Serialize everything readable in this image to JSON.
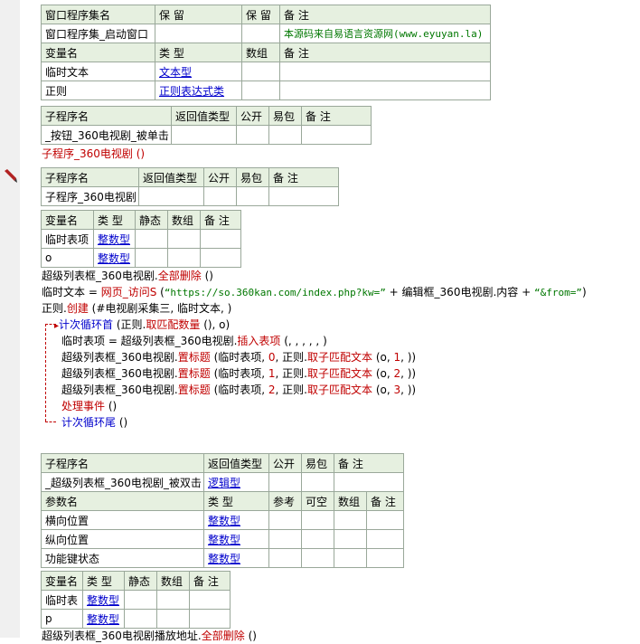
{
  "assembly_table": {
    "headers": [
      "窗口程序集名",
      "保 留",
      "保 留",
      "备 注"
    ],
    "row": {
      "name": "窗口程序集_启动窗口",
      "r1": "",
      "r2": "",
      "note": "本源码来自易语言资源网(www.eyuyan.la)"
    },
    "var_headers": [
      "变量名",
      "类 型",
      "数组",
      "备 注"
    ],
    "vars": [
      {
        "name": "临时文本",
        "type": "文本型",
        "arr": "",
        "note": ""
      },
      {
        "name": "正则",
        "type": "正则表达式类",
        "arr": "",
        "note": ""
      }
    ]
  },
  "sub1": {
    "headers": [
      "子程序名",
      "返回值类型",
      "公开",
      "易包",
      "备 注"
    ],
    "name": "_按钮_360电视剧_被单击",
    "call_line": "子程序_360电视剧 ()"
  },
  "sub2": {
    "headers": [
      "子程序名",
      "返回值类型",
      "公开",
      "易包",
      "备 注"
    ],
    "name": "子程序_360电视剧",
    "var_headers": [
      "变量名",
      "类 型",
      "静态",
      "数组",
      "备 注"
    ],
    "vars": [
      {
        "name": "临时表项",
        "type": "整数型"
      },
      {
        "name": "o",
        "type": "整数型"
      }
    ],
    "code": {
      "l1a": "超级列表框_360电视剧.",
      "l1b": "全部删除",
      "l1c": " ()",
      "l2a": "临时文本 = ",
      "l2b": "网页_访问S",
      "l2c": " (",
      "l2d": "“https://so.360kan.com/index.php?kw=”",
      "l2e": " + 编辑框_360电视剧.内容 + ",
      "l2f": "“&from=”",
      "l2g": ")",
      "l3a": "正则.",
      "l3b": "创建",
      "l3c": " (#电视剧采集三, 临时文本, )",
      "l4a": "计次循环首",
      "l4b": " (正则.",
      "l4c": "取匹配数量",
      "l4d": " (), o)",
      "l5a": "临时表项 = 超级列表框_360电视剧.",
      "l5b": "插入表项",
      "l5c": " (, , , , , )",
      "l6a": "超级列表框_360电视剧.",
      "l6b": "置标题",
      "l6c": " (临时表项, ",
      "l6d": "0",
      "l6e": ", 正则.",
      "l6f": "取子匹配文本",
      "l6g": " (o, ",
      "l6h": "1",
      "l6i": ", ))",
      "l7a": "超级列表框_360电视剧.",
      "l7b": "置标题",
      "l7c": " (临时表项, ",
      "l7d": "1",
      "l7e": ", 正则.",
      "l7f": "取子匹配文本",
      "l7g": " (o, ",
      "l7h": "2",
      "l7i": ", ))",
      "l8a": "超级列表框_360电视剧.",
      "l8b": "置标题",
      "l8c": " (临时表项, ",
      "l8d": "2",
      "l8e": ", 正则.",
      "l8f": "取子匹配文本",
      "l8g": " (o, ",
      "l8h": "3",
      "l8i": ", ))",
      "l9a": "处理事件",
      "l9b": " ()",
      "l10a": "计次循环尾",
      "l10b": " ()"
    }
  },
  "sub3": {
    "headers": [
      "子程序名",
      "返回值类型",
      "公开",
      "易包",
      "备 注"
    ],
    "name": "_超级列表框_360电视剧_被双击",
    "ret": "逻辑型",
    "param_headers": [
      "参数名",
      "类 型",
      "参考",
      "可空",
      "数组",
      "备 注"
    ],
    "params": [
      {
        "name": "横向位置",
        "type": "整数型"
      },
      {
        "name": "纵向位置",
        "type": "整数型"
      },
      {
        "name": "功能键状态",
        "type": "整数型"
      }
    ],
    "var_headers": [
      "变量名",
      "类 型",
      "静态",
      "数组",
      "备 注"
    ],
    "vars": [
      {
        "name": "临时表",
        "type": "整数型"
      },
      {
        "name": "p",
        "type": "整数型"
      }
    ],
    "last_a": "超级列表框_360电视剧播放地址.",
    "last_b": "全部删除",
    "last_c": " ()"
  }
}
